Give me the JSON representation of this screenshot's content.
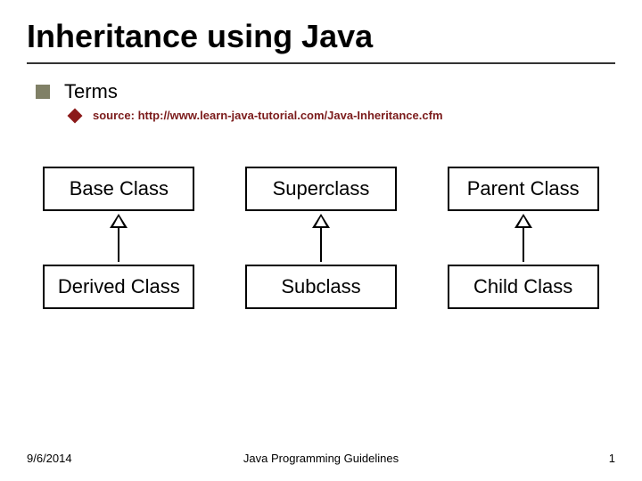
{
  "title": "Inheritance using Java",
  "bullets": {
    "terms": "Terms",
    "source": "source: http://www.learn-java-tutorial.com/Java-Inheritance.cfm"
  },
  "pairs": [
    {
      "top": "Base Class",
      "bottom": "Derived Class"
    },
    {
      "top": "Superclass",
      "bottom": "Subclass"
    },
    {
      "top": "Parent Class",
      "bottom": "Child Class"
    }
  ],
  "footer": {
    "date": "9/6/2014",
    "center": "Java Programming Guidelines",
    "page": "1"
  }
}
